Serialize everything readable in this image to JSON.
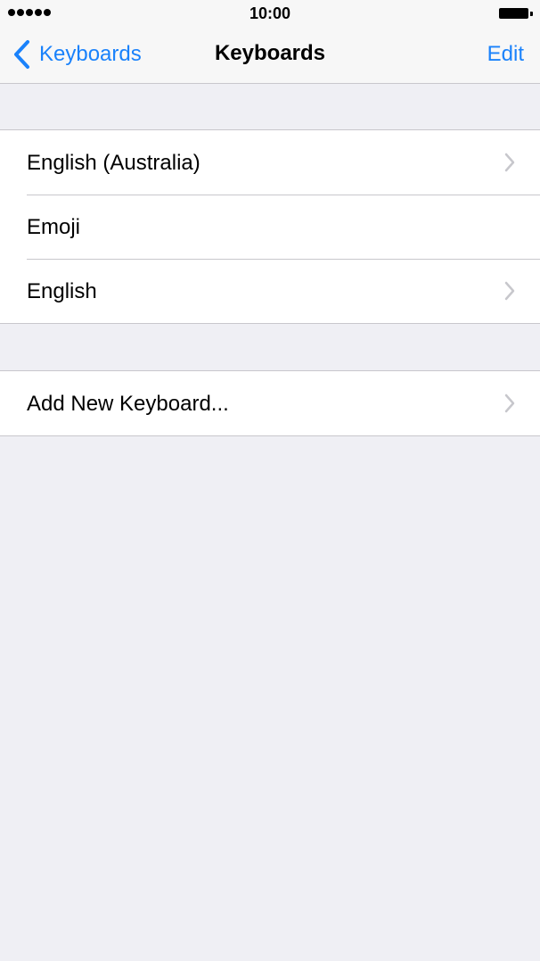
{
  "status_bar": {
    "time": "10:00",
    "signal_dots": 5,
    "battery_level": 1.0
  },
  "nav": {
    "back_label": "Keyboards",
    "title": "Keyboards",
    "edit_label": "Edit"
  },
  "keyboards": [
    {
      "label": "English (Australia)",
      "has_chevron": true
    },
    {
      "label": "Emoji",
      "has_chevron": false
    },
    {
      "label": "English",
      "has_chevron": true
    }
  ],
  "add_keyboard": {
    "label": "Add New Keyboard...",
    "has_chevron": true
  },
  "colors": {
    "tint": "#1a82fb",
    "background": "#efeff4",
    "bar": "#f7f7f7",
    "separator": "#c8c7cc",
    "chevron": "#c7c7cc"
  },
  "icons": {
    "back": "chevron-left-icon",
    "disclosure": "chevron-right-icon",
    "signal": "signal-icon",
    "battery": "battery-icon"
  }
}
